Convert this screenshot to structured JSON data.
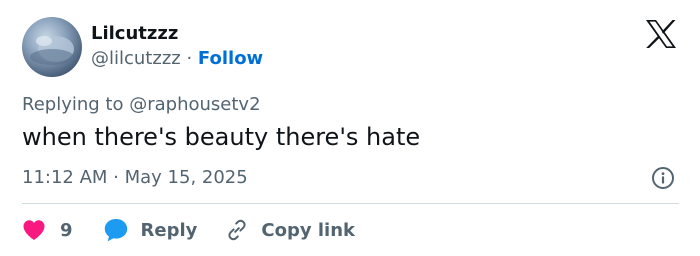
{
  "user": {
    "display_name": "Lilcutzzz",
    "handle": "@lilcutzzz",
    "separator": "·",
    "follow_label": "Follow"
  },
  "reply_context": {
    "prefix": "Replying to",
    "mention": "@raphousetv2"
  },
  "tweet": {
    "text": "when there's beauty there's hate",
    "timestamp": "11:12 AM · May 15, 2025"
  },
  "actions": {
    "like_count": "9",
    "reply_label": "Reply",
    "copy_link_label": "Copy link"
  },
  "icons": {
    "logo": "x-logo-icon",
    "info": "info-icon",
    "like": "heart-icon",
    "reply": "speech-bubble-icon",
    "copy": "link-icon"
  },
  "colors": {
    "text_primary": "#0f1419",
    "text_secondary": "#536471",
    "link": "#006fd6",
    "like": "#f91880",
    "reply": "#1d9bf0",
    "divider": "#cfd9de"
  }
}
